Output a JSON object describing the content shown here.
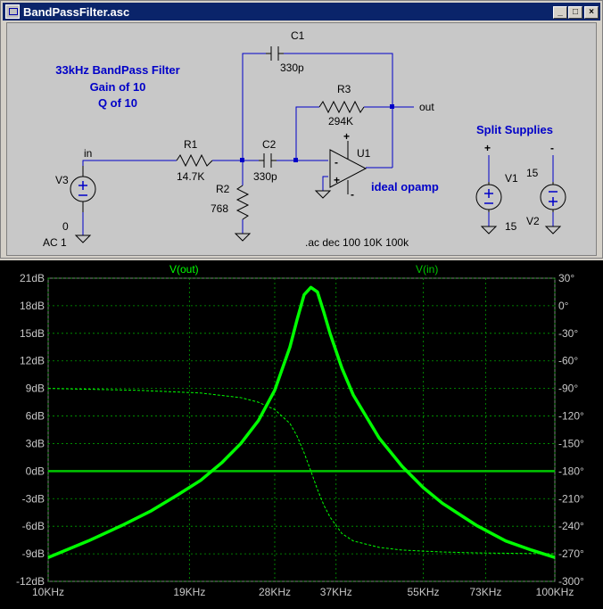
{
  "window": {
    "title": "BandPassFilter.asc",
    "buttons": {
      "minimize": "_",
      "maximize": "□",
      "close": "×"
    }
  },
  "schematic": {
    "notes": [
      "33kHz BandPass Filter",
      "Gain of 10",
      "Q of 10"
    ],
    "split_supplies": "Split Supplies",
    "opamp_note": "ideal opamp",
    "directive": ".ac dec 100 10K 100k",
    "nets": {
      "in": "in",
      "out": "out"
    },
    "components": {
      "C1": {
        "name": "C1",
        "value": "330p"
      },
      "C2": {
        "name": "C2",
        "value": "330p"
      },
      "R1": {
        "name": "R1",
        "value": "14.7K"
      },
      "R2": {
        "name": "R2",
        "value": "768"
      },
      "R3": {
        "name": "R3",
        "value": "294K"
      },
      "U1": {
        "name": "U1"
      },
      "V1": {
        "name": "V1",
        "value": "15"
      },
      "V2": {
        "name": "V2",
        "value": "15"
      },
      "V3": {
        "name": "V3",
        "value": "0",
        "ac": "AC 1"
      }
    },
    "supply_marks": {
      "plus": "+",
      "minus": "-"
    }
  },
  "colors": {
    "vout": "#00ff00",
    "vin": "#00c800",
    "wire": "#0000c8",
    "grid": "#00a000",
    "schem_bg": "#c8c8c8",
    "plot_bg": "#000000"
  },
  "chart_data": {
    "type": "line",
    "legend": [
      "V(out)",
      "V(in)"
    ],
    "x_scale": "log",
    "xlim": [
      10000,
      100000
    ],
    "x_ticks": [
      10000,
      19000,
      28000,
      37000,
      55000,
      73000,
      100000
    ],
    "x_tick_labels": [
      "10KHz",
      "19KHz",
      "28KHz",
      "37KHz",
      "55KHz",
      "73KHz",
      "100KHz"
    ],
    "ylim_left": [
      -12,
      21
    ],
    "y_ticks_left": [
      21,
      18,
      15,
      12,
      9,
      6,
      3,
      0,
      -3,
      -6,
      -9,
      -12
    ],
    "y_tick_labels_left": [
      "21dB",
      "18dB",
      "15dB",
      "12dB",
      "9dB",
      "6dB",
      "3dB",
      "0dB",
      "-3dB",
      "-6dB",
      "-9dB",
      "-12dB"
    ],
    "ylim_right": [
      -300,
      30
    ],
    "y_ticks_right": [
      30,
      0,
      -30,
      -60,
      -90,
      -120,
      -150,
      -180,
      -210,
      -240,
      -270,
      -300
    ],
    "y_tick_labels_right": [
      "30°",
      "0°",
      "-30°",
      "-60°",
      "-90°",
      "-120°",
      "-150°",
      "-180°",
      "-210°",
      "-240°",
      "-270°",
      "-300°"
    ],
    "grid": true,
    "series": [
      {
        "name": "V(out)",
        "axis": "left",
        "x": [
          10000,
          12000,
          14000,
          16000,
          18000,
          20000,
          22000,
          24000,
          26000,
          28000,
          30000,
          31000,
          32000,
          33000,
          34000,
          35000,
          36000,
          38000,
          40000,
          45000,
          50000,
          55000,
          60000,
          70000,
          80000,
          90000,
          100000
        ],
        "y": [
          -9.4,
          -7.6,
          -5.9,
          -4.3,
          -2.6,
          -1.0,
          0.9,
          3.0,
          5.5,
          8.8,
          13.5,
          16.5,
          19.2,
          20.0,
          19.5,
          17.3,
          15.0,
          11.2,
          8.3,
          3.6,
          0.5,
          -1.8,
          -3.5,
          -5.9,
          -7.6,
          -8.6,
          -9.4
        ]
      },
      {
        "name": "V(in) magnitude",
        "axis": "left",
        "x": [
          10000,
          100000
        ],
        "y": [
          0,
          0
        ]
      },
      {
        "name": "V(out) phase",
        "axis": "right",
        "x": [
          10000,
          15000,
          20000,
          24000,
          26000,
          28000,
          30000,
          31000,
          32000,
          33000,
          34000,
          35000,
          36000,
          38000,
          40000,
          45000,
          50000,
          60000,
          70000,
          100000
        ],
        "y": [
          -90,
          -92,
          -95,
          -100,
          -105,
          -113,
          -128,
          -142,
          -160,
          -180,
          -200,
          -217,
          -230,
          -248,
          -256,
          -263,
          -266,
          -268,
          -269,
          -270
        ]
      }
    ]
  }
}
